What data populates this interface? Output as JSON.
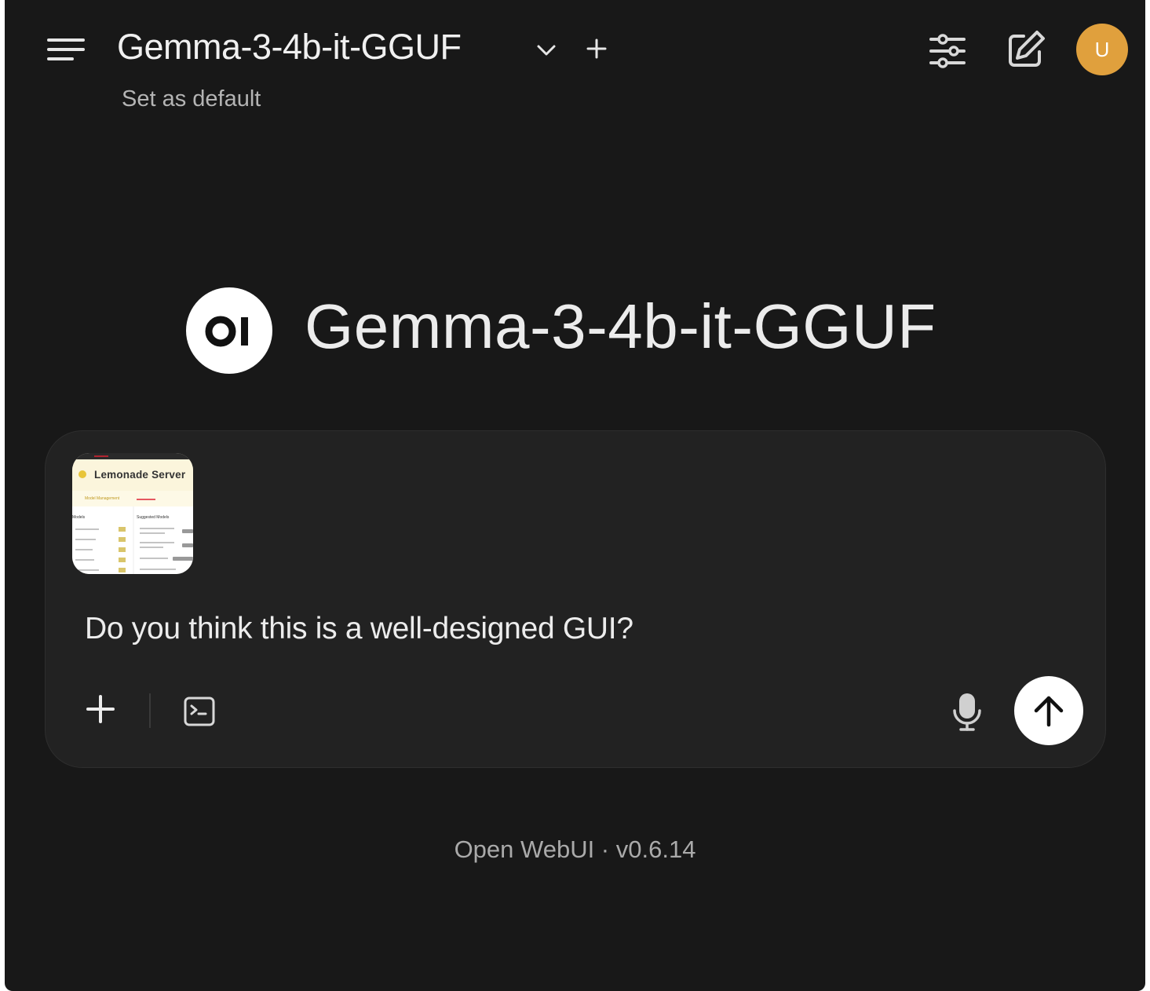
{
  "header": {
    "model_name": "Gemma-3-4b-it-GGUF",
    "set_default_label": "Set as default",
    "avatar_initial": "U"
  },
  "hero": {
    "logo_text": "OI",
    "model_name": "Gemma-3-4b-it-GGUF"
  },
  "composer": {
    "attachment": {
      "title": "Lemonade Server",
      "subtitle": "Model Management",
      "col_left": "Models",
      "col_right": "Suggested Models"
    },
    "prompt": "Do you think this is a well-designed GUI?"
  },
  "footer": {
    "version": "Open WebUI · v0.6.14"
  },
  "colors": {
    "background": "#181818",
    "composer": "#222222",
    "avatar": "#e0a03d",
    "send_button": "#ffffff"
  },
  "icons": [
    "menu-icon",
    "chevron-down-icon",
    "plus-icon",
    "sliders-icon",
    "edit-icon",
    "code-icon",
    "microphone-icon",
    "arrow-up-icon"
  ]
}
